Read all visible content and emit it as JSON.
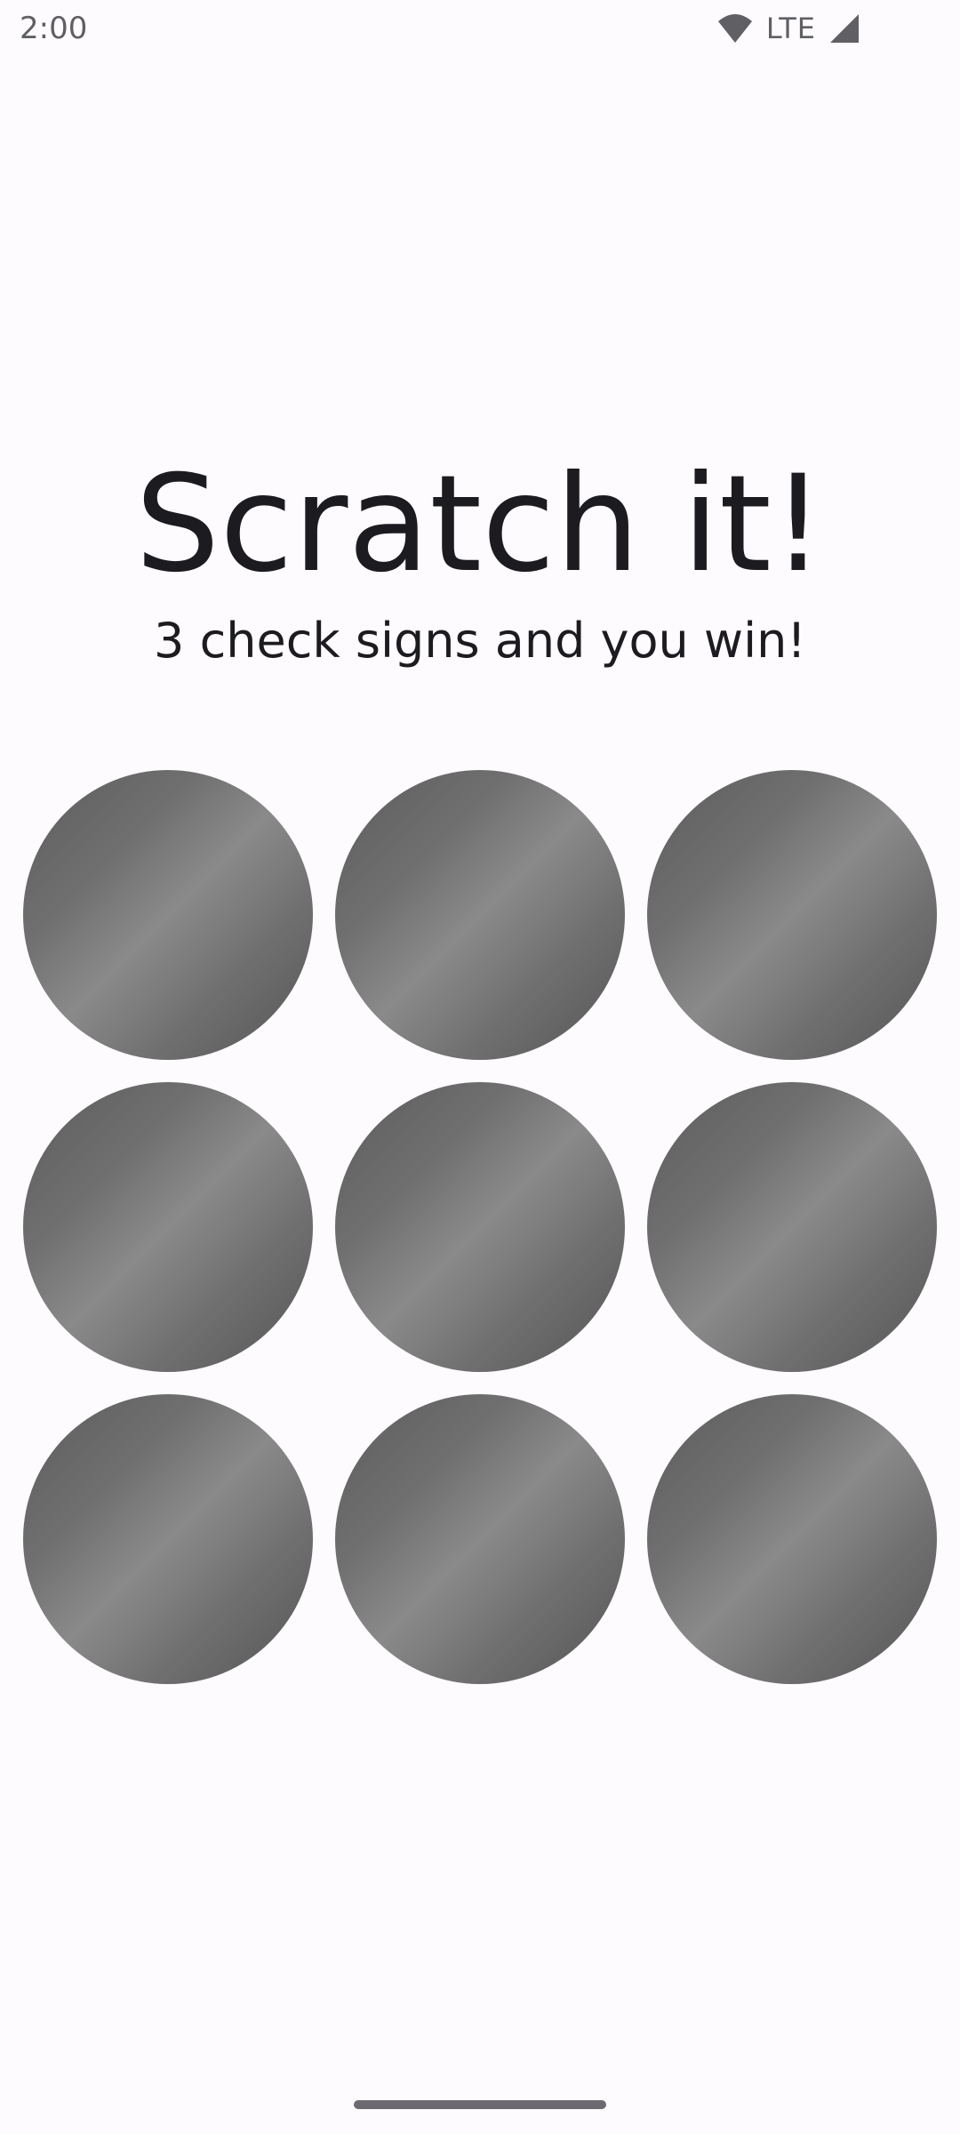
{
  "status_bar": {
    "time": "2:00",
    "network_label": "LTE",
    "icons": [
      "wifi-icon",
      "cell-signal-icon"
    ],
    "icon_color": "#5f5f64"
  },
  "main": {
    "title": "Scratch it!",
    "subtitle": "3 check signs and you win!"
  },
  "scratch_grid": {
    "rows": 3,
    "columns": 3,
    "cells": [
      {
        "id": "cell-1"
      },
      {
        "id": "cell-2"
      },
      {
        "id": "cell-3"
      },
      {
        "id": "cell-4"
      },
      {
        "id": "cell-5"
      },
      {
        "id": "cell-6"
      },
      {
        "id": "cell-7"
      },
      {
        "id": "cell-8"
      },
      {
        "id": "cell-9"
      }
    ],
    "colors": {
      "dark": "#5c5c5c",
      "light": "#8a8a8a"
    }
  },
  "theme": {
    "background": "#fdfbfe",
    "text": "#1c1b1f",
    "nav_handle": "#6c6a70"
  }
}
